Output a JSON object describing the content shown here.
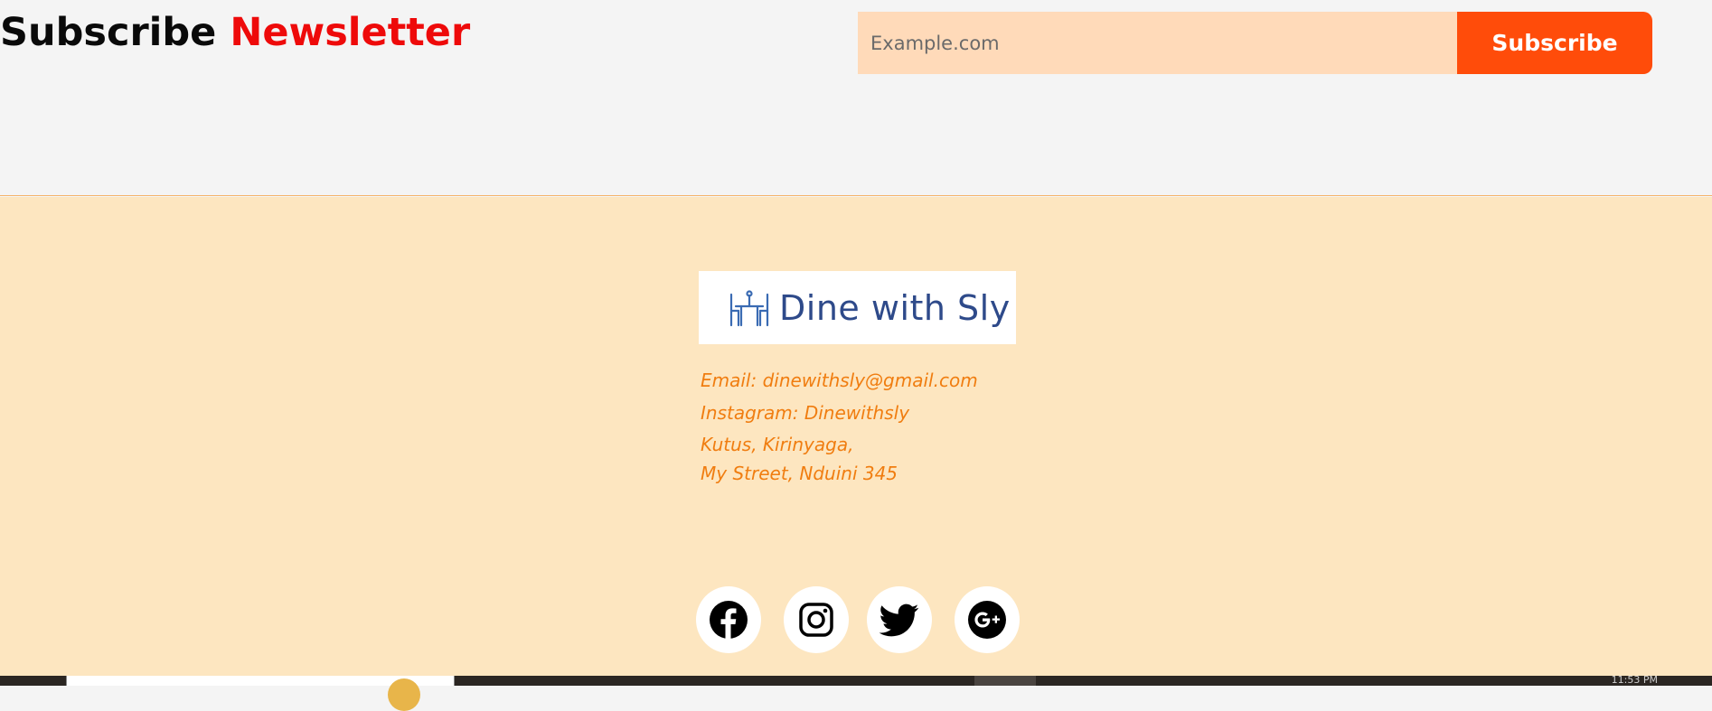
{
  "newsletter": {
    "title_part1": "Subscribe",
    "title_part2": "Newsletter",
    "input_placeholder": "Example.com",
    "input_value": "",
    "button_label": "Subscribe"
  },
  "footer": {
    "logo": {
      "text": "Dine with Sly",
      "icon": "dining-table-icon"
    },
    "contact": {
      "email": "Email: dinewithsly@gmail.com",
      "instagram": "Instagram: Dinewithsly",
      "address_line1": "Kutus, Kirinyaga,",
      "address_line2": "My Street, Nduini 345"
    },
    "social": [
      {
        "name": "facebook",
        "icon": "facebook-icon"
      },
      {
        "name": "instagram",
        "icon": "instagram-icon"
      },
      {
        "name": "twitter",
        "icon": "twitter-icon"
      },
      {
        "name": "google-plus",
        "icon": "google-plus-icon"
      }
    ]
  },
  "taskbar": {
    "clock": "11:53 PM"
  },
  "colors": {
    "accent_red": "#ee0a0a",
    "button_orange": "#ff4c0a",
    "input_bg": "#ffdab9",
    "footer_bg": "#fde6c0",
    "contact_text": "#f07d10",
    "logo_text": "#2e4a8a"
  }
}
